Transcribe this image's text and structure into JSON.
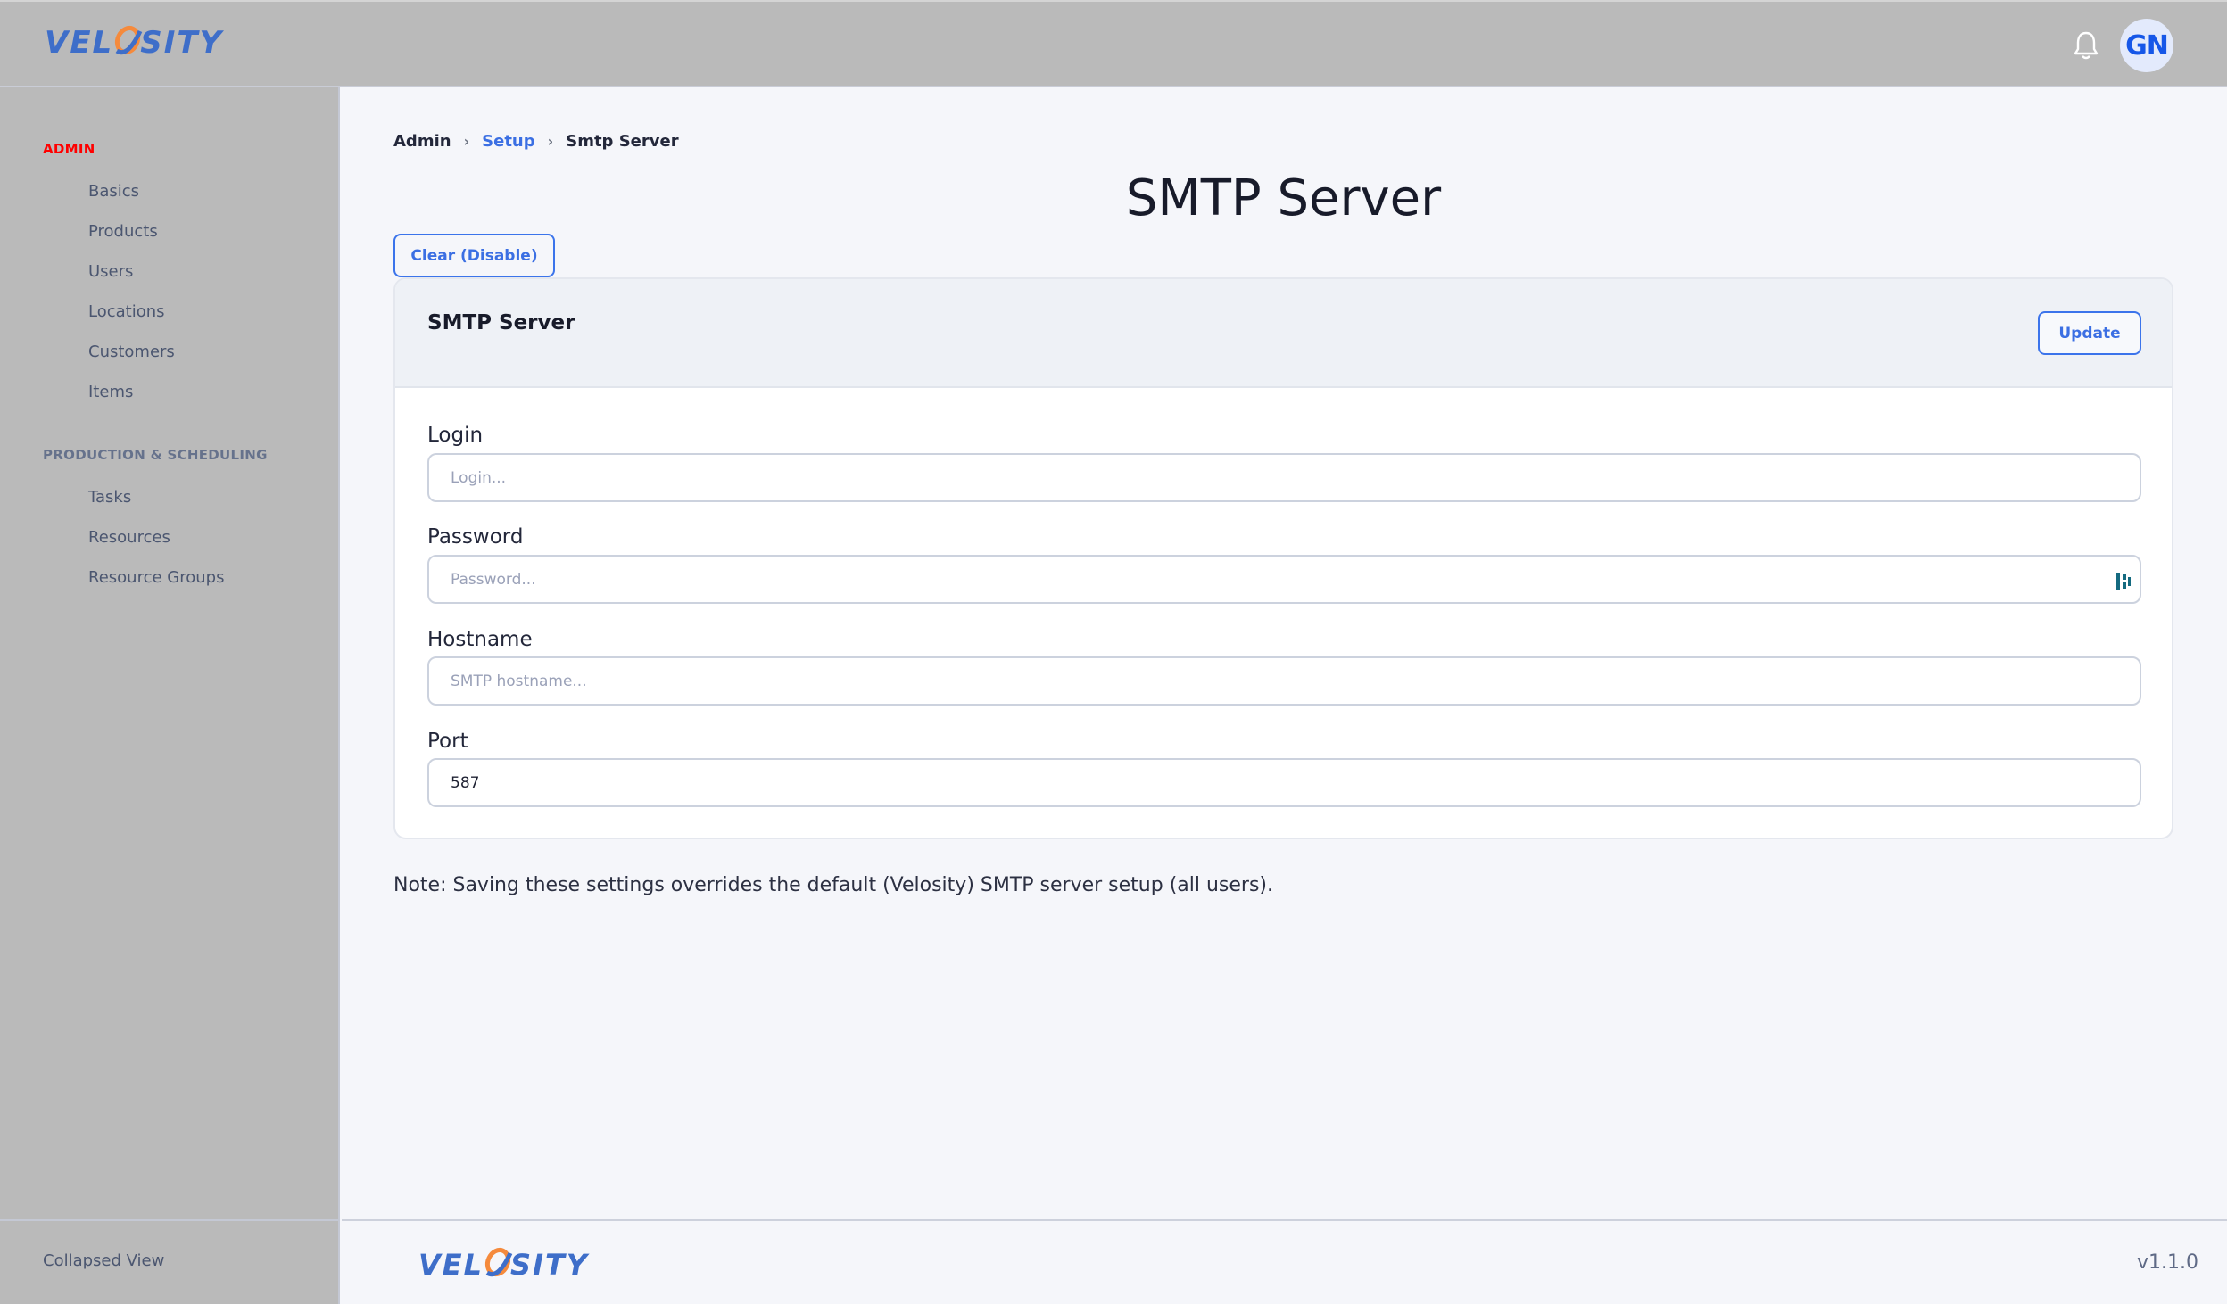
{
  "app": {
    "logo_text_left": "VEL",
    "logo_text_right": "SITY",
    "brand_color": "#3e6ec9",
    "logo_accent_color": "#f58a3c"
  },
  "topbar": {
    "notification_icon": "bell-icon",
    "avatar_initials": "GN"
  },
  "sidebar": {
    "sections": [
      {
        "title": "ADMIN",
        "active": true,
        "items": [
          {
            "label": "Basics"
          },
          {
            "label": "Products"
          },
          {
            "label": "Users"
          },
          {
            "label": "Locations"
          },
          {
            "label": "Customers"
          },
          {
            "label": "Items"
          }
        ]
      },
      {
        "title": "PRODUCTION & SCHEDULING",
        "active": false,
        "items": [
          {
            "label": "Tasks"
          },
          {
            "label": "Resources"
          },
          {
            "label": "Resource Groups"
          }
        ]
      }
    ],
    "collapsed_view_label": "Collapsed View"
  },
  "breadcrumb": [
    {
      "label": "Admin",
      "link": false
    },
    {
      "label": "Setup",
      "link": true
    },
    {
      "label": "Smtp Server",
      "link": false
    }
  ],
  "page": {
    "title": "SMTP Server",
    "clear_button_label": "Clear (Disable)"
  },
  "card": {
    "title": "SMTP Server",
    "update_button_label": "Update",
    "fields": [
      {
        "label": "Login",
        "placeholder": "Login...",
        "value": ""
      },
      {
        "label": "Password",
        "placeholder": "Password...",
        "value": "",
        "icon": "password-manager-icon"
      },
      {
        "label": "Hostname",
        "placeholder": "SMTP hostname...",
        "value": ""
      },
      {
        "label": "Port",
        "placeholder": "",
        "value": "587"
      }
    ]
  },
  "note": "Note: Saving these settings overrides the default (Velosity) SMTP server setup (all users).",
  "footer": {
    "version": "v1.1.0"
  }
}
